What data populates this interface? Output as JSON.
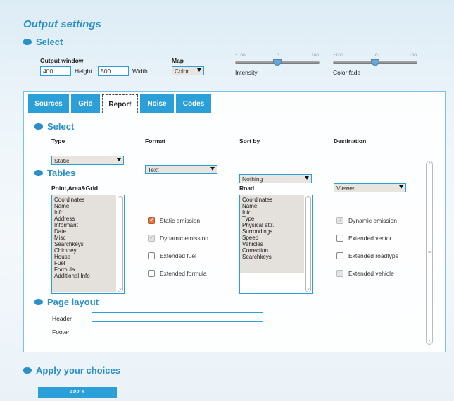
{
  "page_title": "Output settings",
  "top_select": {
    "heading": "Select",
    "output_window_label": "Output window",
    "height_value": "400",
    "height_label": "Height",
    "width_value": "500",
    "width_label": "Width",
    "map_label": "Map",
    "map_value": "Color",
    "intensity": {
      "min": "−100",
      "mid": "0",
      "max": "100",
      "label": "Intensity",
      "value": 0
    },
    "color_fade": {
      "min": "−100",
      "mid": "0",
      "max": "100",
      "label": "Color fade",
      "value": 0
    }
  },
  "tabs": [
    {
      "label": "Sources",
      "active": false
    },
    {
      "label": "Grid",
      "active": false
    },
    {
      "label": "Report",
      "active": true
    },
    {
      "label": "Noise",
      "active": false
    },
    {
      "label": "Codes",
      "active": false
    }
  ],
  "report": {
    "select_heading": "Select",
    "type_label": "Type",
    "type_value": "Static",
    "format_label": "Format",
    "format_value": "Text",
    "sort_label": "Sort by",
    "sort_value": "Nothing",
    "destination_label": "Destination",
    "destination_value": "Viewer",
    "tables_heading": "Tables",
    "point_label": "Point,Area&Grid",
    "point_items": [
      "Coordinates",
      "Name",
      "Info",
      "Address",
      "Informant",
      "Date",
      "Misc",
      "Searchkeys",
      "Chimney",
      "House",
      "Fuel",
      "Formula",
      "Additional Info"
    ],
    "point_checkboxes": [
      {
        "label": "Static emission",
        "checked": true,
        "disabled": false
      },
      {
        "label": "Dynamic emission",
        "checked": true,
        "disabled": true
      },
      {
        "label": "Extended fuel",
        "checked": false,
        "disabled": false
      },
      {
        "label": "Extended formula",
        "checked": false,
        "disabled": false
      }
    ],
    "road_label": "Road",
    "road_items": [
      "Coordinates",
      "Name",
      "Info",
      "Type",
      "Physical attr.",
      "Surrondings",
      "Speed",
      "Vehicles",
      "Correction",
      "Searchkeys"
    ],
    "road_checkboxes": [
      {
        "label": "Dynamic emission",
        "checked": true,
        "disabled": true
      },
      {
        "label": "Extended vector",
        "checked": false,
        "disabled": false
      },
      {
        "label": "Extended roadtype",
        "checked": false,
        "disabled": false
      },
      {
        "label": "Extended vehicle",
        "checked": false,
        "disabled": true
      }
    ],
    "layout_heading": "Page layout",
    "header_label": "Header",
    "header_value": "",
    "footer_label": "Footer",
    "footer_value": ""
  },
  "apply": {
    "heading": "Apply your choices",
    "button_label": "APPLY"
  },
  "colors": {
    "accent": "#2b9fd8",
    "heading": "#2b8fc8",
    "checked": "#e07840"
  }
}
